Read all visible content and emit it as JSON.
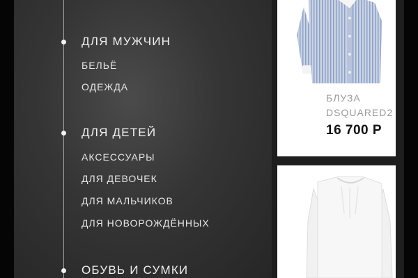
{
  "menu": {
    "sections": [
      {
        "heading": "ДЛЯ МУЖЧИН",
        "items": [
          "БЕЛЬЁ",
          "ОДЕЖДА"
        ]
      },
      {
        "heading": "ДЛЯ ДЕТЕЙ",
        "items": [
          "АКСЕССУАРЫ",
          "ДЛЯ ДЕВОЧЕК",
          "ДЛЯ МАЛЬЧИКОВ",
          "ДЛЯ НОВОРОЖДЁННЫХ"
        ]
      },
      {
        "heading": "ОБУВЬ И СУМКИ",
        "items": []
      }
    ]
  },
  "products": [
    {
      "category": "БЛУЗА",
      "brand": "DSQUARED2",
      "price": "16 700 Р",
      "image_icon": "striped-shirt-icon"
    },
    {
      "image_icon": "white-blouse-icon"
    }
  ]
}
